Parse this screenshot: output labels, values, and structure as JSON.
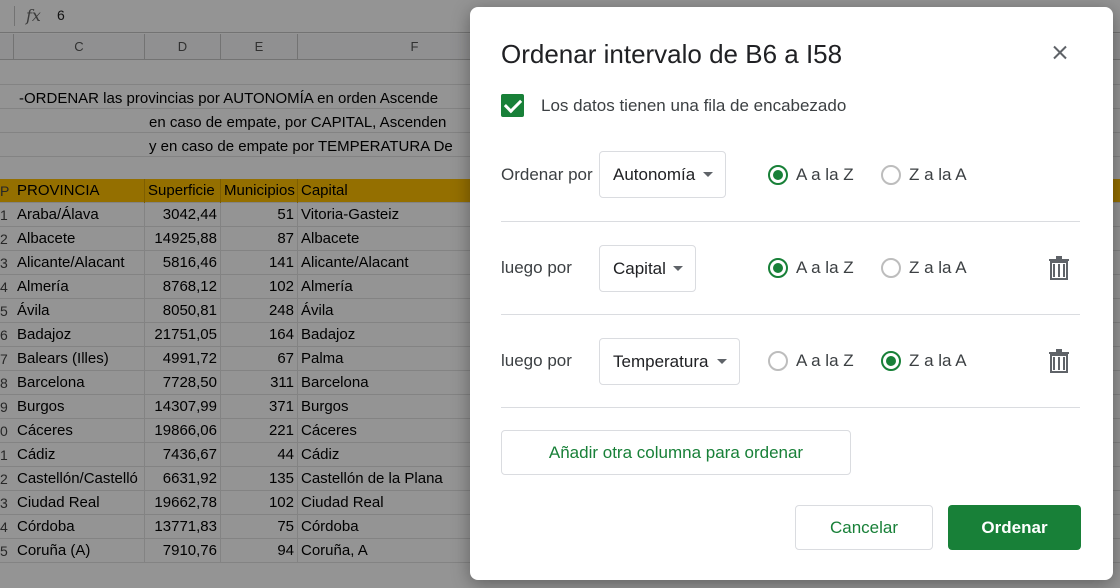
{
  "formula_bar": {
    "fx_label": "fx",
    "value": "6"
  },
  "columns": [
    {
      "id": "col-c",
      "label": "C"
    },
    {
      "id": "col-d",
      "label": "D"
    },
    {
      "id": "col-e",
      "label": "E"
    },
    {
      "id": "col-f",
      "label": "F"
    }
  ],
  "notes": [
    "-ORDENAR las provincias por AUTONOMÍA en orden Ascende",
    "en caso de empate, por CAPITAL, Ascenden",
    "y en caso de empate por TEMPERATURA De"
  ],
  "table_header": {
    "rownum": "P",
    "provincia": "PROVINCIA",
    "superficie": "Superficie",
    "municipios": "Municipios",
    "capital": "Capital"
  },
  "table_rows": [
    {
      "rownum": "1",
      "provincia": "Araba/Álava",
      "superficie": "3042,44",
      "municipios": "51",
      "capital": "Vitoria-Gasteiz"
    },
    {
      "rownum": "2",
      "provincia": "Albacete",
      "superficie": "14925,88",
      "municipios": "87",
      "capital": "Albacete"
    },
    {
      "rownum": "3",
      "provincia": "Alicante/Alacant",
      "superficie": "5816,46",
      "municipios": "141",
      "capital": "Alicante/Alacant"
    },
    {
      "rownum": "4",
      "provincia": "Almería",
      "superficie": "8768,12",
      "municipios": "102",
      "capital": "Almería"
    },
    {
      "rownum": "5",
      "provincia": "Ávila",
      "superficie": "8050,81",
      "municipios": "248",
      "capital": "Ávila"
    },
    {
      "rownum": "6",
      "provincia": "Badajoz",
      "superficie": "21751,05",
      "municipios": "164",
      "capital": "Badajoz"
    },
    {
      "rownum": "7",
      "provincia": "Balears (Illes)",
      "superficie": "4991,72",
      "municipios": "67",
      "capital": "Palma"
    },
    {
      "rownum": "8",
      "provincia": "Barcelona",
      "superficie": "7728,50",
      "municipios": "311",
      "capital": "Barcelona"
    },
    {
      "rownum": "9",
      "provincia": "Burgos",
      "superficie": "14307,99",
      "municipios": "371",
      "capital": "Burgos"
    },
    {
      "rownum": "0",
      "provincia": "Cáceres",
      "superficie": "19866,06",
      "municipios": "221",
      "capital": "Cáceres"
    },
    {
      "rownum": "1",
      "provincia": "Cádiz",
      "superficie": "7436,67",
      "municipios": "44",
      "capital": "Cádiz"
    },
    {
      "rownum": "2",
      "provincia": "Castellón/Castelló",
      "superficie": "6631,92",
      "municipios": "135",
      "capital": "Castellón de la Plana"
    },
    {
      "rownum": "3",
      "provincia": "Ciudad Real",
      "superficie": "19662,78",
      "municipios": "102",
      "capital": "Ciudad Real"
    },
    {
      "rownum": "4",
      "provincia": "Córdoba",
      "superficie": "13771,83",
      "municipios": "75",
      "capital": "Córdoba"
    },
    {
      "rownum": "5",
      "provincia": "Coruña (A)",
      "superficie": "7910,76",
      "municipios": "94",
      "capital": "Coruña, A"
    }
  ],
  "dialog": {
    "title": "Ordenar intervalo de B6 a I58",
    "header_checkbox_label": "Los datos tienen una fila de encabezado",
    "header_checkbox_checked": true,
    "sort_rules": [
      {
        "label": "Ordenar por",
        "column": "Autonomía",
        "order": "asc",
        "asc_label": "A a la Z",
        "desc_label": "Z a la A",
        "deletable": false
      },
      {
        "label": "luego por",
        "column": "Capital",
        "order": "asc",
        "asc_label": "A a la Z",
        "desc_label": "Z a la A",
        "deletable": true
      },
      {
        "label": "luego por",
        "column": "Temperatura",
        "order": "desc",
        "asc_label": "A a la Z",
        "desc_label": "Z a la A",
        "deletable": true
      }
    ],
    "add_button": "Añadir otra columna para ordenar",
    "cancel_button": "Cancelar",
    "ok_button": "Ordenar"
  },
  "colors": {
    "accent": "#188038",
    "header_fill": "#ffc000"
  }
}
